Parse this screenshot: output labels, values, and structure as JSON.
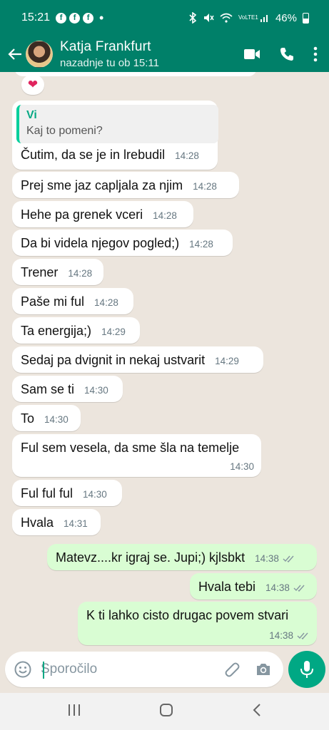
{
  "status_bar": {
    "time": "15:21",
    "fb_icons": [
      "f",
      "f",
      "f"
    ],
    "dot": "•",
    "network": "VoLTE1",
    "battery": "46%"
  },
  "header": {
    "contact_name": "Katja Frankfurt",
    "last_seen": "nazadnje tu ob 15:11"
  },
  "reaction": "❤",
  "messages": [
    {
      "type": "in",
      "quote_author": "Vi",
      "quote_text": "Kaj to pomeni?",
      "text": "Čutim, da se je in lrebudil",
      "time": "14:28"
    },
    {
      "type": "in",
      "text": "Prej sme jaz capljala za njim",
      "time": "14:28"
    },
    {
      "type": "in",
      "text": "Hehe pa grenek vceri",
      "time": "14:28"
    },
    {
      "type": "in",
      "text": "Da bi videla njegov pogled;)",
      "time": "14:28"
    },
    {
      "type": "in",
      "text": "Trener",
      "time": "14:28"
    },
    {
      "type": "in",
      "text": "Paše mi ful",
      "time": "14:28"
    },
    {
      "type": "in",
      "text": "Ta energija;)",
      "time": "14:29"
    },
    {
      "type": "in",
      "text": "Sedaj pa dvignit in nekaj ustvarit",
      "time": "14:29"
    },
    {
      "type": "in",
      "text": "Sam se ti",
      "time": "14:30"
    },
    {
      "type": "in",
      "text": "To",
      "time": "14:30"
    },
    {
      "type": "in",
      "text": "Ful sem vesela, da sme šla na temelje",
      "time": "14:30"
    },
    {
      "type": "in",
      "text": "Ful ful ful",
      "time": "14:30"
    },
    {
      "type": "in",
      "text": "Hvala",
      "time": "14:31"
    },
    {
      "type": "out",
      "text": "Matevz....kr igraj se. Jupi;) kjlsbkt",
      "time": "14:38"
    },
    {
      "type": "out",
      "text": "Hvala tebi",
      "time": "14:38"
    },
    {
      "type": "out",
      "text": "K ti lahko cisto drugac povem stvari",
      "time": "14:38"
    }
  ],
  "composer": {
    "placeholder": "Sporočilo",
    "value": ""
  },
  "colors": {
    "header": "#008069",
    "outgoing_bubble": "#d9fdd3",
    "accent": "#00a884",
    "read_ticks": "#8696a0"
  }
}
